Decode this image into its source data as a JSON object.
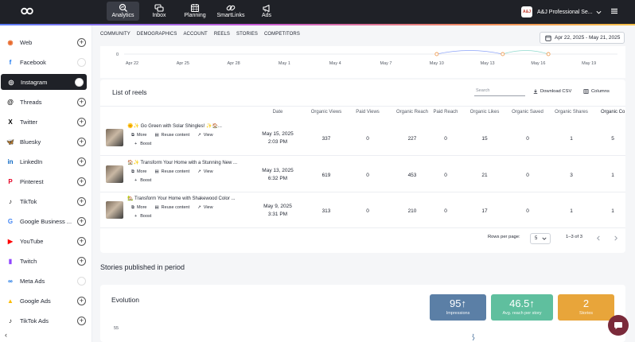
{
  "nav": {
    "items": [
      {
        "label": "Analytics",
        "icon": "analytics-icon",
        "active": true
      },
      {
        "label": "Inbox",
        "icon": "inbox-icon",
        "active": false
      },
      {
        "label": "Planning",
        "icon": "calendar-icon",
        "active": false
      },
      {
        "label": "SmartLinks",
        "icon": "link-icon",
        "active": false
      },
      {
        "label": "Ads",
        "icon": "megaphone-icon",
        "active": false
      }
    ],
    "brand_name": "A&J Professional Se..."
  },
  "sidebar": {
    "items": [
      {
        "label": "Web",
        "icon": "rss-icon",
        "color": "#e8692b",
        "action": "add"
      },
      {
        "label": "Facebook",
        "icon": "facebook-icon",
        "color": "#1877f2",
        "action": "avatar"
      },
      {
        "label": "Instagram",
        "icon": "instagram-icon",
        "color": "#ffffff",
        "action": "avatar",
        "active": true
      },
      {
        "label": "Threads",
        "icon": "threads-icon",
        "color": "#000000",
        "action": "add"
      },
      {
        "label": "Twitter",
        "icon": "x-icon",
        "color": "#000000",
        "action": "add"
      },
      {
        "label": "Bluesky",
        "icon": "bluesky-icon",
        "color": "#1185fe",
        "action": "add"
      },
      {
        "label": "LinkedIn",
        "icon": "linkedin-icon",
        "color": "#0a66c2",
        "action": "add"
      },
      {
        "label": "Pinterest",
        "icon": "pinterest-icon",
        "color": "#e60023",
        "action": "add"
      },
      {
        "label": "TikTok",
        "icon": "tiktok-icon",
        "color": "#000000",
        "action": "add"
      },
      {
        "label": "Google Business ...",
        "icon": "google-business-icon",
        "color": "#4285f4",
        "action": "add"
      },
      {
        "label": "YouTube",
        "icon": "youtube-icon",
        "color": "#ff0000",
        "action": "add"
      },
      {
        "label": "Twitch",
        "icon": "twitch-icon",
        "color": "#9146ff",
        "action": "add"
      },
      {
        "label": "Meta Ads",
        "icon": "meta-icon",
        "color": "#0668e1",
        "action": "avatar"
      },
      {
        "label": "Google Ads",
        "icon": "google-ads-icon",
        "color": "#fbbc04",
        "action": "add"
      },
      {
        "label": "TikTok Ads",
        "icon": "tiktok-icon",
        "color": "#000000",
        "action": "add"
      }
    ]
  },
  "subnav": {
    "tabs": [
      "COMMUNITY",
      "DEMOGRAPHICS",
      "ACCOUNT",
      "REELS",
      "STORIES",
      "COMPETITORS"
    ],
    "date_range": "Apr 22, 2025 - May 21, 2025"
  },
  "mini_chart": {
    "y_tick": "0",
    "x_ticks": [
      "Apr 22",
      "Apr 25",
      "Apr 28",
      "May 1",
      "May 4",
      "May 7",
      "May 10",
      "May 13",
      "May 16",
      "May 19"
    ],
    "series_colors": [
      "#f0a35e",
      "#5b7cf5",
      "#5fc9b8"
    ]
  },
  "reels": {
    "title": "List of reels",
    "search_placeholder": "Search",
    "download_label": "Download CSV",
    "columns_label": "Columns",
    "headers": [
      "Date",
      "Organic Views",
      "Paid Views",
      "Organic Reach",
      "Paid Reach",
      "Organic Likes",
      "Organic Saved",
      "Organic Shares",
      "Organic Co"
    ],
    "actions": {
      "more": "More",
      "reuse": "Reuse content",
      "view": "View",
      "boost": "Boost"
    },
    "rows": [
      {
        "title": "🌞✨ Go Green with Solar Shingles! ✨🏠...",
        "date": "May 15, 2025",
        "time": "2:03 PM",
        "values": [
          "337",
          "0",
          "227",
          "0",
          "15",
          "0",
          "1",
          "5"
        ]
      },
      {
        "title": "🏠✨ Transform Your Home with a Stunning New ...",
        "date": "May 13, 2025",
        "time": "6:32 PM",
        "values": [
          "619",
          "0",
          "453",
          "0",
          "21",
          "0",
          "3",
          "1"
        ]
      },
      {
        "title": "🏡 Transform Your Home with Shakewood Color ...",
        "date": "May 9, 2025",
        "time": "3:31 PM",
        "values": [
          "313",
          "0",
          "210",
          "0",
          "17",
          "0",
          "1",
          "1"
        ]
      }
    ],
    "rows_per_page_label": "Rows per page:",
    "rows_per_page": "5",
    "page_info": "1–3 of 3"
  },
  "stories": {
    "title": "Stories published in period",
    "evolution_title": "Evolution",
    "y_tick": "55",
    "stats": [
      {
        "value": "95",
        "arrow": "↑",
        "label": "Impressions",
        "color": "#5b7fa6"
      },
      {
        "value": "46.5",
        "arrow": "↑",
        "label": "Avg. reach per story",
        "color": "#5fbf9e"
      },
      {
        "value": "2",
        "arrow": "",
        "label": "Stories",
        "color": "#e8a53a"
      }
    ]
  }
}
